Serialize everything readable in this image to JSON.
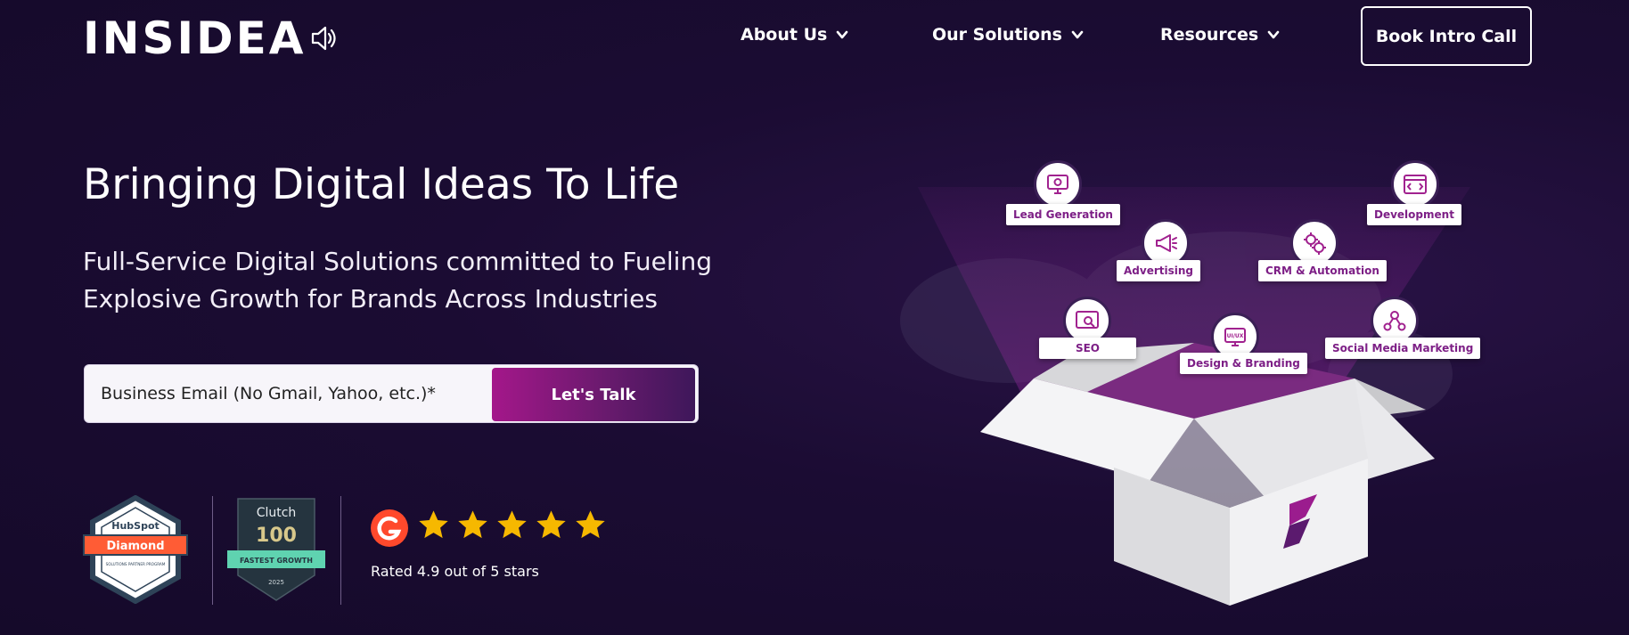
{
  "header": {
    "logo_text": "INSIDEA",
    "nav": [
      {
        "label": "About Us"
      },
      {
        "label": "Our Solutions"
      },
      {
        "label": "Resources"
      }
    ],
    "cta_label": "Book Intro Call"
  },
  "hero": {
    "title": "Bringing Digital Ideas To Life",
    "subtitle_line1": "Full-Service Digital Solutions committed to Fueling",
    "subtitle_line2": "Explosive Growth for Brands Across Industries",
    "email_placeholder": "Business Email (No Gmail, Yahoo, etc.)*",
    "submit_label": "Let's Talk"
  },
  "badges": {
    "hubspot": {
      "brand": "HubSpot",
      "tier": "Diamond",
      "program": "SOLUTIONS PARTNER PROGRAM"
    },
    "clutch": {
      "brand": "Clutch",
      "rank": "100",
      "ribbon": "FASTEST GROWTH",
      "year": "2025"
    },
    "g2": {
      "logo": "G2",
      "stars": 5,
      "rating_text": "Rated 4.9 out of 5 stars"
    }
  },
  "services": [
    {
      "label": "Lead Generation",
      "icon": "monitor-gear-icon"
    },
    {
      "label": "Advertising",
      "icon": "megaphone-icon"
    },
    {
      "label": "CRM & Automation",
      "icon": "gears-icon"
    },
    {
      "label": "Development",
      "icon": "browser-code-icon"
    },
    {
      "label": "SEO",
      "icon": "seo-analytics-icon"
    },
    {
      "label": "Design & Branding",
      "icon": "ui-ux-icon"
    },
    {
      "label": "Social Media Marketing",
      "icon": "social-network-icon"
    }
  ],
  "ui_ux_icon_text": "UI/UX",
  "colors": {
    "background": "#1b0c33",
    "accent": "#a4178a",
    "accent_dark": "#3e175a",
    "star": "#f6b800",
    "g2_red": "#ff492c",
    "hubspot_orange": "#ff5c35",
    "clutch_green": "#5fd3b0"
  }
}
